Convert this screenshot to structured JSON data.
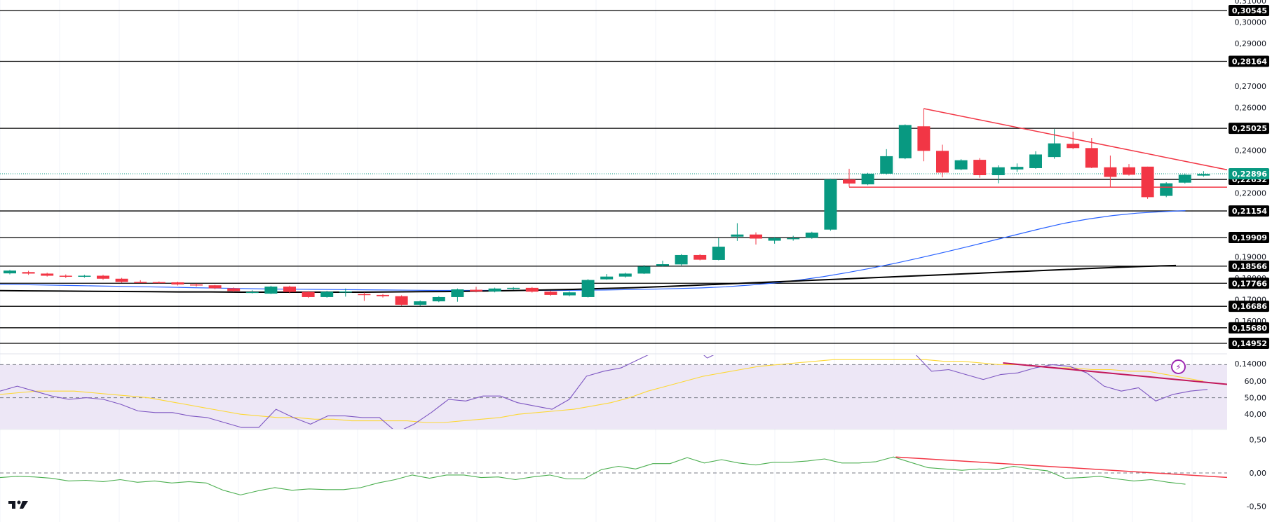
{
  "chart_data": [
    {
      "type": "candlestick",
      "name": "price",
      "yticks": [
        "0,31000",
        "0,30000",
        "0,29000",
        "0,27000",
        "0,26000",
        "0,24000",
        "0,22000",
        "0,19000",
        "0,18000",
        "0,17000",
        "0,16000",
        "0,14000"
      ],
      "ytick_values": [
        0.31,
        0.3,
        0.29,
        0.27,
        0.26,
        0.24,
        0.22,
        0.19,
        0.18,
        0.17,
        0.16,
        0.14
      ],
      "levels": [
        "0,30545",
        "0,28164",
        "0,25025",
        "0,22632",
        "0,21154",
        "0,19909",
        "0,18566",
        "0,17766",
        "0,16686",
        "0,15680",
        "0,14952"
      ],
      "level_values": [
        0.30545,
        0.28164,
        0.25025,
        0.22632,
        0.21154,
        0.19909,
        0.18566,
        0.17766,
        0.16686,
        0.1568,
        0.14952
      ],
      "current_price_label": "0,22896",
      "current_price": 0.22896,
      "ohlc": [
        [
          0.1823,
          0.1836,
          0.1818,
          0.1839
        ],
        [
          0.1829,
          0.1822,
          0.1816,
          0.1835
        ],
        [
          0.1822,
          0.1812,
          0.1808,
          0.1826
        ],
        [
          0.1812,
          0.1807,
          0.1801,
          0.1818
        ],
        [
          0.1807,
          0.1812,
          0.1803,
          0.1816
        ],
        [
          0.1812,
          0.1798,
          0.1793,
          0.1816
        ],
        [
          0.1798,
          0.1783,
          0.1779,
          0.1802
        ],
        [
          0.1783,
          0.1781,
          0.1778,
          0.1791
        ],
        [
          0.1782,
          0.1781,
          0.1776,
          0.1785
        ],
        [
          0.1781,
          0.1771,
          0.1766,
          0.1784
        ],
        [
          0.1771,
          0.1766,
          0.1761,
          0.1776
        ],
        [
          0.1767,
          0.1753,
          0.1749,
          0.1769
        ],
        [
          0.1753,
          0.174,
          0.1736,
          0.1757
        ],
        [
          0.1736,
          0.1736,
          0.1729,
          0.1744
        ],
        [
          0.1728,
          0.1761,
          0.1726,
          0.1765
        ],
        [
          0.1761,
          0.1736,
          0.173,
          0.1765
        ],
        [
          0.1736,
          0.1712,
          0.1708,
          0.174
        ],
        [
          0.1712,
          0.1737,
          0.1709,
          0.1741
        ],
        [
          0.1738,
          0.1738,
          0.1714,
          0.1752
        ],
        [
          0.1726,
          0.1722,
          0.1694,
          0.1733
        ],
        [
          0.1722,
          0.1716,
          0.171,
          0.1726
        ],
        [
          0.1716,
          0.1676,
          0.1672,
          0.172
        ],
        [
          0.1676,
          0.1692,
          0.167,
          0.1696
        ],
        [
          0.1692,
          0.1712,
          0.1688,
          0.1716
        ],
        [
          0.1712,
          0.1748,
          0.169,
          0.1752
        ],
        [
          0.1746,
          0.1738,
          0.1734,
          0.176
        ],
        [
          0.1738,
          0.1752,
          0.1734,
          0.1756
        ],
        [
          0.1752,
          0.1755,
          0.1746,
          0.1759
        ],
        [
          0.1755,
          0.1737,
          0.1733,
          0.1759
        ],
        [
          0.1737,
          0.1722,
          0.1718,
          0.1741
        ],
        [
          0.172,
          0.1734,
          0.1716,
          0.1738
        ],
        [
          0.1712,
          0.1792,
          0.171,
          0.1796
        ],
        [
          0.1795,
          0.1808,
          0.1793,
          0.182
        ],
        [
          0.1808,
          0.1822,
          0.1803,
          0.1826
        ],
        [
          0.1822,
          0.1855,
          0.182,
          0.1862
        ],
        [
          0.1858,
          0.1866,
          0.1854,
          0.1882
        ],
        [
          0.1865,
          0.1909,
          0.186,
          0.1913
        ],
        [
          0.1909,
          0.1887,
          0.1884,
          0.1913
        ],
        [
          0.1886,
          0.1948,
          0.1884,
          0.1988
        ],
        [
          0.1995,
          0.2005,
          0.1975,
          0.2058
        ],
        [
          0.2005,
          0.1986,
          0.1958,
          0.2015
        ],
        [
          0.1976,
          0.1988,
          0.1962,
          0.1994
        ],
        [
          0.1986,
          0.1988,
          0.1976,
          0.1999
        ],
        [
          0.199,
          0.2014,
          0.1985,
          0.2018
        ],
        [
          0.2028,
          0.2263,
          0.2023,
          0.2267
        ],
        [
          0.2263,
          0.2244,
          0.2229,
          0.2313
        ],
        [
          0.224,
          0.229,
          0.2236,
          0.2294
        ],
        [
          0.229,
          0.2372,
          0.2286,
          0.2405
        ],
        [
          0.2362,
          0.2518,
          0.2358,
          0.2521
        ],
        [
          0.2512,
          0.2397,
          0.2348,
          0.2596
        ],
        [
          0.2397,
          0.2295,
          0.2273,
          0.2426
        ],
        [
          0.231,
          0.2353,
          0.2306,
          0.2358
        ],
        [
          0.2355,
          0.2283,
          0.2271,
          0.2363
        ],
        [
          0.2283,
          0.232,
          0.2245,
          0.2329
        ],
        [
          0.231,
          0.2322,
          0.2298,
          0.2338
        ],
        [
          0.2316,
          0.238,
          0.2313,
          0.2395
        ],
        [
          0.2368,
          0.2432,
          0.236,
          0.2499
        ],
        [
          0.243,
          0.241,
          0.2405,
          0.2487
        ],
        [
          0.241,
          0.2318,
          0.2316,
          0.2457
        ],
        [
          0.232,
          0.2275,
          0.2226,
          0.2375
        ],
        [
          0.232,
          0.2285,
          0.2281,
          0.2335
        ],
        [
          0.2323,
          0.218,
          0.2172,
          0.2323
        ],
        [
          0.2186,
          0.2245,
          0.218,
          0.225
        ],
        [
          0.2248,
          0.2285,
          0.2244,
          0.2291
        ],
        [
          0.2281,
          0.2289,
          0.2276,
          0.2302
        ]
      ],
      "ma_blue": [
        0.1772,
        0.177,
        0.1768,
        0.1766,
        0.1764,
        0.1762,
        0.176,
        0.1758,
        0.1756,
        0.1754,
        0.1752,
        0.175,
        0.1749,
        0.1748,
        0.1747,
        0.1746,
        0.1745,
        0.1744,
        0.1743,
        0.1743,
        0.1743,
        0.1743,
        0.1743,
        0.1743,
        0.1744,
        0.1745,
        0.1747,
        0.1749,
        0.1752,
        0.1755,
        0.176,
        0.1768,
        0.1778,
        0.1791,
        0.1807,
        0.1826,
        0.1847,
        0.187,
        0.1895,
        0.1921,
        0.1948,
        0.1976,
        0.2004,
        0.2032,
        0.2058,
        0.2078,
        0.2094,
        0.2105,
        0.2112,
        0.2117
      ],
      "ma_black": [
        0.1742,
        0.1741,
        0.174,
        0.1739,
        0.1738,
        0.1737,
        0.1736,
        0.1736,
        0.1735,
        0.1735,
        0.1735,
        0.1735,
        0.1735,
        0.1736,
        0.1737,
        0.1738,
        0.174,
        0.1742,
        0.1745,
        0.1748,
        0.1752,
        0.1756,
        0.1761,
        0.1767,
        0.1773,
        0.1779,
        0.1785,
        0.1791,
        0.1797,
        0.1803,
        0.1809,
        0.1815,
        0.1821,
        0.1827,
        0.1833,
        0.1839,
        0.1845,
        0.1851,
        0.1856,
        0.186
      ],
      "trendlines": [
        {
          "from": [
            49,
            0.2595
          ],
          "to": [
            68,
            0.226
          ]
        },
        {
          "from": [
            45,
            0.2227
          ],
          "to": [
            68,
            0.2227
          ]
        }
      ]
    },
    {
      "type": "line",
      "name": "rsi",
      "yticks": [
        "60,00",
        "50,00",
        "40,00"
      ],
      "ytick_values": [
        60,
        50,
        40
      ],
      "band": [
        30,
        70
      ],
      "rsi": [
        54,
        57,
        54,
        51,
        49,
        50,
        49,
        46,
        42,
        41,
        41,
        39,
        38,
        35,
        32,
        32,
        43,
        38,
        34,
        39,
        39,
        38,
        38,
        29,
        34,
        41,
        49,
        48,
        51,
        51,
        47,
        45,
        43,
        49,
        63,
        66,
        68,
        73,
        78,
        80,
        83,
        74,
        79,
        79,
        81,
        85,
        83,
        80,
        82,
        85,
        84,
        80,
        84,
        77,
        66,
        67,
        64,
        61,
        64,
        65,
        68,
        70,
        69,
        65,
        57,
        54,
        56,
        48,
        52,
        54,
        55
      ],
      "rsi_ma": [
        52,
        53,
        54,
        54,
        54,
        53,
        52,
        51,
        50,
        48,
        46,
        44,
        42,
        40,
        39,
        38,
        38,
        37,
        37,
        36,
        36,
        36,
        36,
        35,
        35,
        36,
        37,
        38,
        40,
        41,
        42,
        43,
        45,
        47,
        50,
        54,
        57,
        60,
        63,
        65,
        67,
        69,
        70,
        71,
        72,
        73,
        73,
        73,
        73,
        73,
        73,
        72,
        72,
        71,
        70,
        70,
        69,
        68,
        68,
        67,
        67,
        66,
        66,
        64,
        62,
        60
      ],
      "trendline": {
        "from": [
          54,
          71
        ],
        "to": [
          67,
          55
        ]
      }
    },
    {
      "type": "line",
      "name": "momentum",
      "yticks": [
        "0,50",
        "0,00",
        "-0,50"
      ],
      "ytick_values": [
        0.5,
        0,
        -0.5
      ],
      "values": [
        -0.07,
        -0.05,
        -0.06,
        -0.08,
        -0.12,
        -0.11,
        -0.13,
        -0.1,
        -0.14,
        -0.12,
        -0.15,
        -0.13,
        -0.15,
        -0.26,
        -0.33,
        -0.27,
        -0.22,
        -0.26,
        -0.24,
        -0.25,
        -0.25,
        -0.22,
        -0.15,
        -0.1,
        -0.03,
        -0.08,
        -0.03,
        -0.03,
        -0.07,
        -0.06,
        -0.1,
        -0.06,
        -0.03,
        -0.09,
        -0.09,
        0.05,
        0.1,
        0.06,
        0.14,
        0.14,
        0.23,
        0.15,
        0.2,
        0.15,
        0.12,
        0.16,
        0.16,
        0.18,
        0.21,
        0.15,
        0.15,
        0.17,
        0.24,
        0.16,
        0.08,
        0.06,
        0.04,
        0.06,
        0.05,
        0.1,
        0.06,
        0.03,
        -0.08,
        -0.07,
        -0.05,
        -0.09,
        -0.12,
        -0.1,
        -0.14,
        -0.17
      ],
      "trendline": {
        "from": [
          49,
          0.24
        ],
        "to": [
          68,
          -0.16
        ]
      }
    }
  ],
  "colors": {
    "up": "#089981",
    "down": "#f23645",
    "ma_blue": "#2962ff",
    "ma_black": "#000000",
    "trend": "#f23645",
    "rsi": "#7e57c2",
    "rsi_ma": "#fdd835",
    "rsi_band": "#ede7f6",
    "momentum": "#4caf50",
    "accent": "#9c27b0"
  },
  "icons": [
    "tradingview-logo",
    "lightning-icon"
  ]
}
